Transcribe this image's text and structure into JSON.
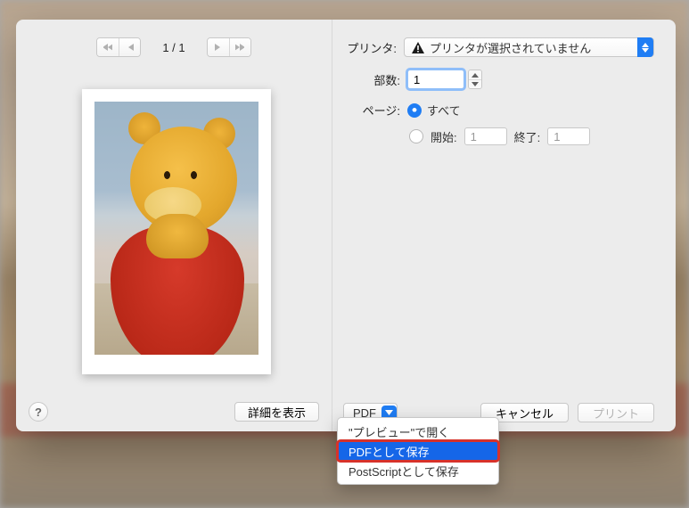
{
  "nav": {
    "page_indicator": "1 / 1"
  },
  "left": {
    "help": "?",
    "show_details": "詳細を表示"
  },
  "printer": {
    "label": "プリンタ:",
    "value": "プリンタが選択されていません"
  },
  "copies": {
    "label": "部数:",
    "value": "1"
  },
  "pages": {
    "label": "ページ:",
    "all_label": "すべて",
    "range_label": "開始:",
    "range_from": "1",
    "range_end_label": "終了:",
    "range_to": "1",
    "selected": "all"
  },
  "bottom": {
    "pdf_label": "PDF",
    "cancel": "キャンセル",
    "print": "プリント"
  },
  "menu": {
    "items": [
      {
        "label": "\"プレビュー\"で開く",
        "selected": false
      },
      {
        "label": "PDFとして保存",
        "selected": true
      },
      {
        "label": "PostScriptとして保存",
        "selected": false
      }
    ]
  }
}
